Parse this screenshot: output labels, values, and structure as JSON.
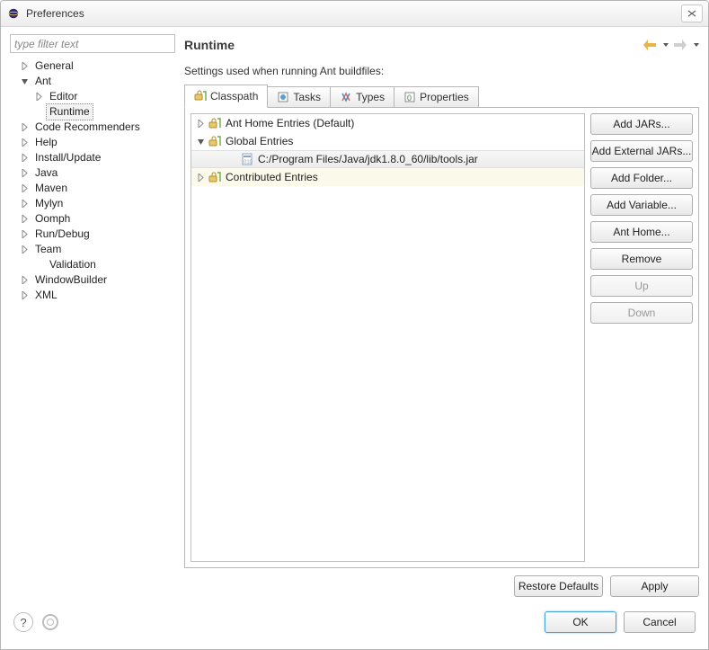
{
  "window": {
    "title": "Preferences"
  },
  "filter": {
    "placeholder": "type filter text"
  },
  "nav_tree": [
    {
      "label": "General",
      "indent": 0,
      "arrow": "right"
    },
    {
      "label": "Ant",
      "indent": 0,
      "arrow": "down"
    },
    {
      "label": "Editor",
      "indent": 1,
      "arrow": "right"
    },
    {
      "label": "Runtime",
      "indent": 1,
      "arrow": "",
      "selected": true
    },
    {
      "label": "Code Recommenders",
      "indent": 0,
      "arrow": "right"
    },
    {
      "label": "Help",
      "indent": 0,
      "arrow": "right"
    },
    {
      "label": "Install/Update",
      "indent": 0,
      "arrow": "right"
    },
    {
      "label": "Java",
      "indent": 0,
      "arrow": "right"
    },
    {
      "label": "Maven",
      "indent": 0,
      "arrow": "right"
    },
    {
      "label": "Mylyn",
      "indent": 0,
      "arrow": "right"
    },
    {
      "label": "Oomph",
      "indent": 0,
      "arrow": "right"
    },
    {
      "label": "Run/Debug",
      "indent": 0,
      "arrow": "right"
    },
    {
      "label": "Team",
      "indent": 0,
      "arrow": "right"
    },
    {
      "label": "Validation",
      "indent": 1,
      "arrow": ""
    },
    {
      "label": "WindowBuilder",
      "indent": 0,
      "arrow": "right"
    },
    {
      "label": "XML",
      "indent": 0,
      "arrow": "right"
    }
  ],
  "page": {
    "title": "Runtime",
    "desc": "Settings used when running Ant buildfiles:"
  },
  "tabs": [
    {
      "label": "Classpath",
      "icon": "classpath-icon",
      "active": true
    },
    {
      "label": "Tasks",
      "icon": "tasks-icon"
    },
    {
      "label": "Types",
      "icon": "types-icon"
    },
    {
      "label": "Properties",
      "icon": "properties-icon"
    }
  ],
  "classpath_entries": [
    {
      "label": "Ant Home Entries (Default)",
      "indent": 0,
      "arrow": "right",
      "icon": "group"
    },
    {
      "label": "Global Entries",
      "indent": 0,
      "arrow": "down",
      "icon": "group"
    },
    {
      "label": "C:/Program Files/Java/jdk1.8.0_60/lib/tools.jar",
      "indent": 2,
      "arrow": "",
      "icon": "jar",
      "sel": true
    },
    {
      "label": "Contributed Entries",
      "indent": 0,
      "arrow": "right",
      "icon": "group",
      "yellow": true
    }
  ],
  "side_buttons": [
    {
      "label": "Add JARs...",
      "enabled": true
    },
    {
      "label": "Add External JARs...",
      "enabled": true
    },
    {
      "label": "Add Folder...",
      "enabled": true
    },
    {
      "label": "Add Variable...",
      "enabled": true
    },
    {
      "label": "Ant Home...",
      "enabled": true
    },
    {
      "label": "Remove",
      "enabled": true
    },
    {
      "label": "Up",
      "enabled": false
    },
    {
      "label": "Down",
      "enabled": false
    }
  ],
  "bottom_buttons": {
    "restore": "Restore Defaults",
    "apply": "Apply"
  },
  "footer_buttons": {
    "ok": "OK",
    "cancel": "Cancel"
  }
}
